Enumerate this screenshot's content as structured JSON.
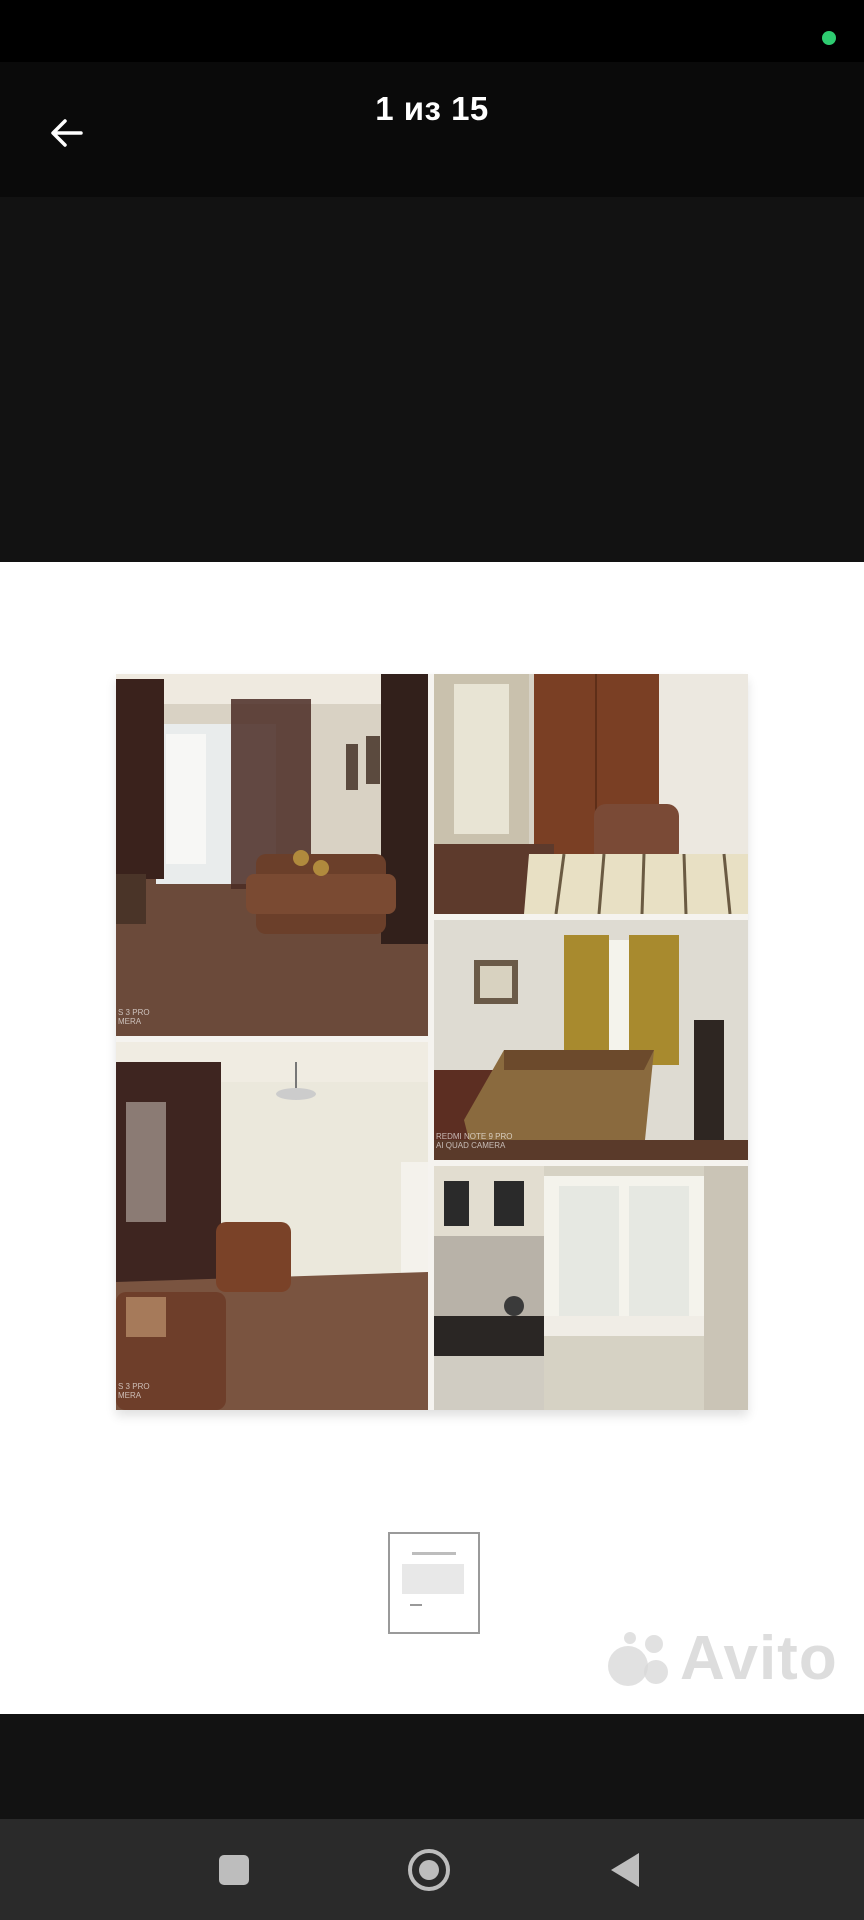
{
  "header": {
    "counter": "1 из 15",
    "back_icon": "arrow-left-icon"
  },
  "status": {
    "indicator_color": "#2ecc71"
  },
  "photo": {
    "watermark": "Avito",
    "tiles": [
      {
        "name": "living-room-tile",
        "watermark": "S 3 PRO\nMERA"
      },
      {
        "name": "bedroom-wardrobe-tile",
        "watermark": ""
      },
      {
        "name": "bedroom-window-tile",
        "watermark": "REDMI NOTE 9 PRO\nAI QUAD CAMERA"
      },
      {
        "name": "living-room-armchair-tile",
        "watermark": "S 3 PRO\nMERA"
      },
      {
        "name": "kitchen-tile",
        "watermark": ""
      }
    ]
  },
  "nav": {
    "recents_icon": "square-icon",
    "home_icon": "circle-home-icon",
    "back_icon": "triangle-back-icon"
  }
}
